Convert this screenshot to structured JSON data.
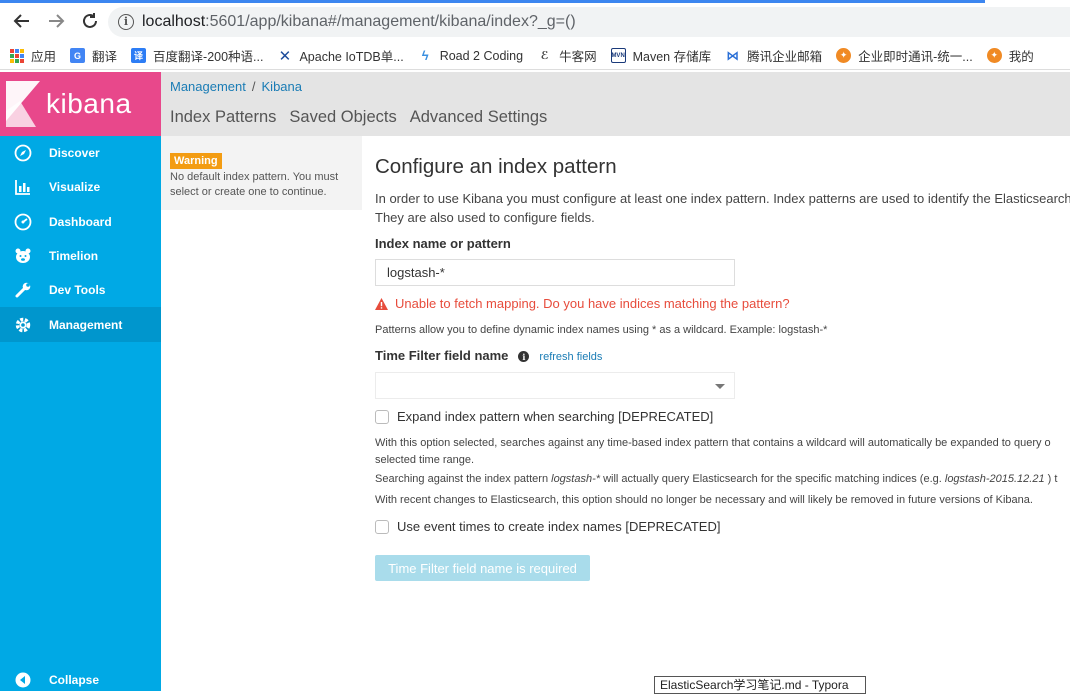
{
  "browser": {
    "url_host": "localhost",
    "url_rest": ":5601/app/kibana#/management/kibana/index?_g=()"
  },
  "bookmarks": [
    {
      "label": "应用",
      "icon": "apps-grid-icon"
    },
    {
      "label": "翻译",
      "icon": "google-translate-icon"
    },
    {
      "label": "百度翻译-200种语...",
      "icon": "baidu-translate-icon"
    },
    {
      "label": "Apache IoTDB单...",
      "icon": "iotdb-icon"
    },
    {
      "label": "Road 2 Coding",
      "icon": "road-coding-icon"
    },
    {
      "label": "牛客网",
      "icon": "nowcoder-icon"
    },
    {
      "label": "Maven 存储库",
      "icon": "maven-icon"
    },
    {
      "label": "腾讯企业邮箱",
      "icon": "tencent-mail-icon"
    },
    {
      "label": "企业即时通讯-统一...",
      "icon": "enterprise-im-icon"
    },
    {
      "label": "我的",
      "icon": "my-icon"
    }
  ],
  "sidebar": {
    "logo_text": "kibana",
    "items": [
      {
        "label": "Discover",
        "icon": "compass-icon"
      },
      {
        "label": "Visualize",
        "icon": "bar-chart-icon"
      },
      {
        "label": "Dashboard",
        "icon": "dashboard-gauge-icon"
      },
      {
        "label": "Timelion",
        "icon": "timelion-bear-icon"
      },
      {
        "label": "Dev Tools",
        "icon": "wrench-icon"
      },
      {
        "label": "Management",
        "icon": "gear-icon"
      }
    ],
    "collapse_label": "Collapse"
  },
  "header": {
    "breadcrumb": [
      "Management",
      "Kibana"
    ],
    "tabs": [
      "Index Patterns",
      "Saved Objects",
      "Advanced Settings"
    ]
  },
  "warning": {
    "badge": "Warning",
    "text": "No default index pattern. You must select or create one to continue."
  },
  "main": {
    "title": "Configure an index pattern",
    "intro_line1": "In order to use Kibana you must configure at least one index pattern. Index patterns are used to identify the Elasticsearch",
    "intro_line2": "They are also used to configure fields.",
    "index_label": "Index name or pattern",
    "index_value": "logstash-*",
    "error": "Unable to fetch mapping. Do you have indices matching the pattern?",
    "patterns_help": "Patterns allow you to define dynamic index names using * as a wildcard. Example: logstash-*",
    "time_filter_label": "Time Filter field name",
    "refresh_fields": "refresh fields",
    "expand_label": "Expand index pattern when searching [DEPRECATED]",
    "expand_help1": "With this option selected, searches against any time-based index pattern that contains a wildcard will automatically be expanded to query o",
    "expand_help2": "selected time range.",
    "search_help_pre": "Searching against the index pattern ",
    "search_help_pattern": "logstash-*",
    "search_help_mid": " will actually query Elasticsearch for the specific matching indices (e.g. ",
    "search_help_example": "logstash-2015.12.21",
    "search_help_post": " ) t",
    "recent_help": "With recent changes to Elasticsearch, this option should no longer be necessary and will likely be removed in future versions of Kibana.",
    "event_times_label": "Use event times to create index names [DEPRECATED]",
    "submit_label": "Time Filter field name is required"
  },
  "taskbar_tooltip": "ElasticSearch学习笔记.md - Typora",
  "colors": {
    "sidebar": "#00a9e5",
    "logo_bg": "#e8488b",
    "warning": "#f39c12",
    "error": "#e74c3c",
    "link": "#1a7cb5",
    "button_disabled": "#a9dceb"
  }
}
